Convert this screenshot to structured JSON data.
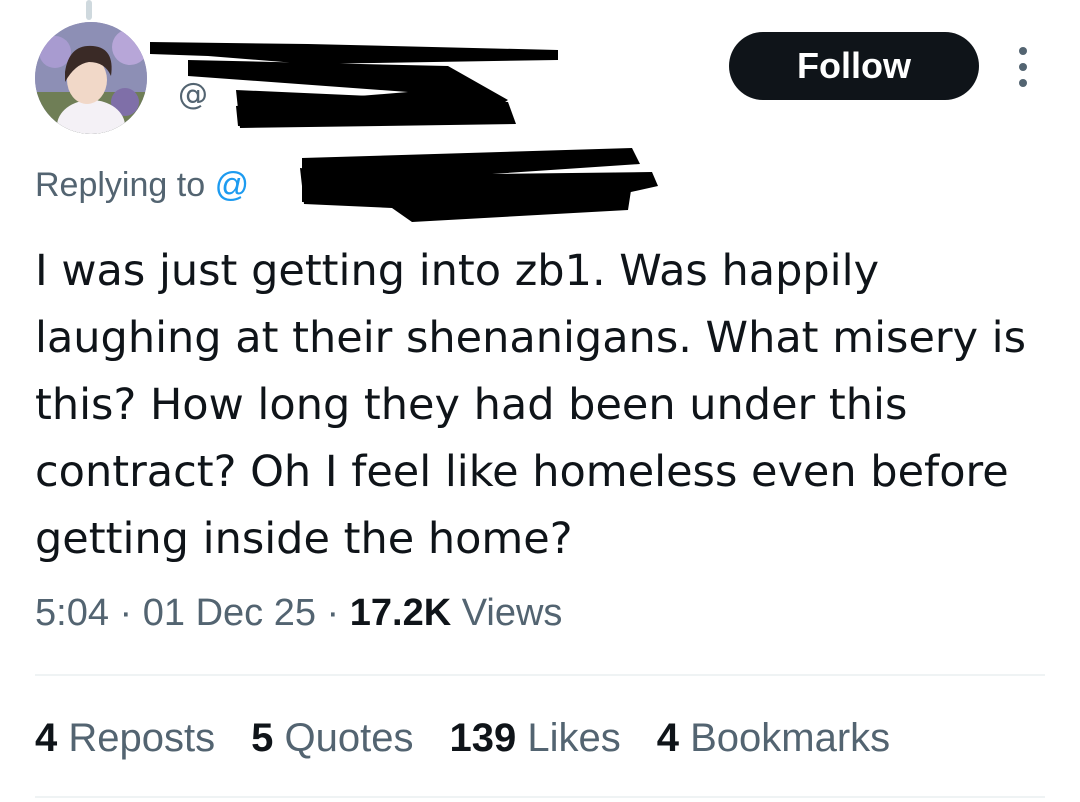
{
  "author": {
    "handle_prefix": "@",
    "avatar_icon": "profile-photo"
  },
  "follow_label": "Follow",
  "more_icon": "more-options-icon",
  "reply": {
    "prefix": "Replying to",
    "at": "@"
  },
  "tweet": {
    "text": "I was just getting into zb1. Was happily laughing at their shenanigans.  What misery is this? How long they had been under this contract? Oh I feel like homeless even before getting inside the home?",
    "time": "5:04",
    "sep1": "·",
    "date": "01 Dec 25",
    "sep2": "·",
    "views_count": "17.2K",
    "views_label": "Views"
  },
  "stats": [
    {
      "count": "4",
      "label": "Reposts"
    },
    {
      "count": "5",
      "label": "Quotes"
    },
    {
      "count": "139",
      "label": "Likes"
    },
    {
      "count": "4",
      "label": "Bookmarks"
    }
  ],
  "colors": {
    "text": "#0f1419",
    "secondary": "#536471",
    "follow_bg": "#0f1419",
    "divider": "#eff3f4",
    "mention": "#1d9bf0"
  }
}
